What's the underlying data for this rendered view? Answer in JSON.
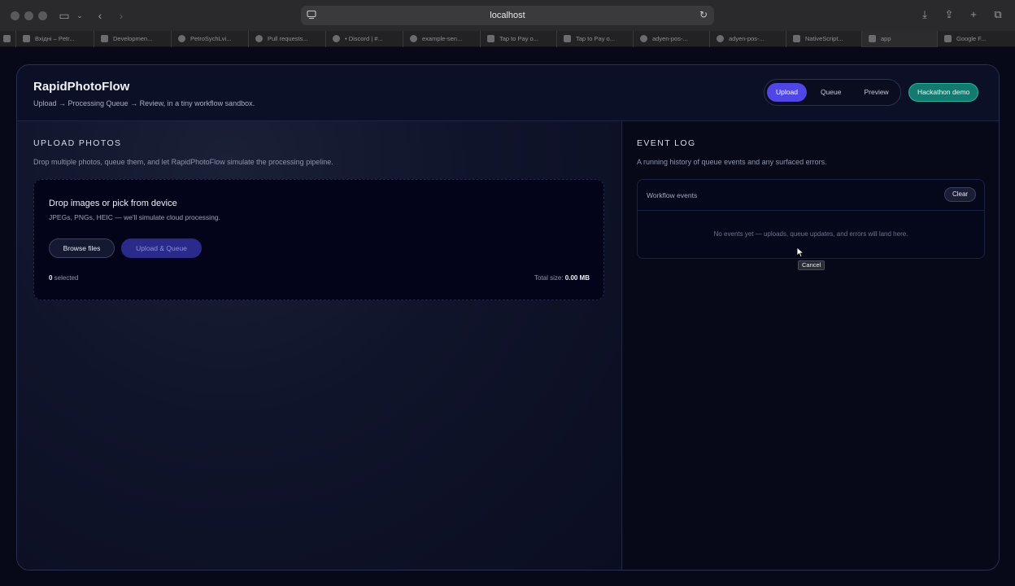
{
  "browser": {
    "address": "localhost",
    "tabs": [
      "Вхідні – Petr...",
      "Developmen...",
      "PetroSychLvi...",
      "Pull requests...",
      "• Discord | #...",
      "example-sen...",
      "Tap to Pay o...",
      "Tap to Pay o...",
      "adyen-pos-...",
      "adyen-pos-...",
      "NativeScript...",
      "app",
      "Google F..."
    ]
  },
  "app": {
    "title": "RapidPhotoFlow",
    "subtitle": "Upload → Processing Queue → Review, in a tiny workflow sandbox.",
    "nav": {
      "upload": "Upload",
      "queue": "Queue",
      "preview": "Preview"
    },
    "demo_label": "Hackathon demo"
  },
  "upload": {
    "section_title": "UPLOAD PHOTOS",
    "description": "Drop multiple photos, queue them, and let RapidPhotoFlow simulate the processing pipeline.",
    "dropzone_title": "Drop images or pick from device",
    "dropzone_sub": "JPEGs, PNGs, HEIC — we'll simulate cloud processing.",
    "browse_label": "Browse files",
    "upload_queue_label": "Upload & Queue",
    "selected_count": "0",
    "selected_suffix": " selected",
    "total_prefix": "Total size: ",
    "total_value": "0.00 MB"
  },
  "events": {
    "section_title": "EVENT LOG",
    "description": "A running history of queue events and any surfaced errors.",
    "panel_label": "Workflow events",
    "clear_label": "Clear",
    "empty_text": "No events yet — uploads, queue updates, and errors will land here."
  },
  "tooltip": "Cancel",
  "colors": {
    "accent": "#4f46e5",
    "demo": "#14796e",
    "background": "#070818"
  }
}
